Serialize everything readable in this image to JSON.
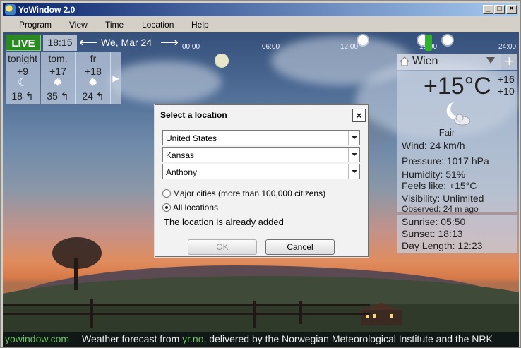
{
  "window": {
    "title": "YoWindow 2.0"
  },
  "menu": [
    "Program",
    "View",
    "Time",
    "Location",
    "Help"
  ],
  "timebar": {
    "live_label": "LIVE",
    "clock": "18:15",
    "date": "We, Mar 24",
    "ticks": [
      "00:00",
      "06:00",
      "12:00",
      "18:00",
      "24:00"
    ]
  },
  "forecast": [
    {
      "day": "tonight",
      "temp": "+9",
      "icon": "moon-icon",
      "wind": "18 ↰"
    },
    {
      "day": "tom.",
      "temp": "+17",
      "icon": "sun-icon",
      "wind": "35 ↰"
    },
    {
      "day": "fr",
      "temp": "+18",
      "icon": "sun-icon",
      "wind": "24 ↰"
    }
  ],
  "panel": {
    "city": "Wien",
    "temperature": "+15°C",
    "high": "+16",
    "low": "+10",
    "condition": "Fair",
    "wind": "Wind:  24 km/h",
    "pressure": "Pressure:  1017 hPa",
    "humidity": "Humidity:  51%",
    "feels_like": "Feels like:  +15°C",
    "visibility": "Visibility:   Unlimited",
    "observed": "Observed:   24 m ago",
    "sunrise": "Sunrise:   05:50",
    "sunset": "Sunset:   18:13",
    "day_length": "Day Length:   12:23"
  },
  "dialog": {
    "title": "Select a location",
    "country": "United States",
    "state": "Kansas",
    "city": "Anthony",
    "radio_major": "Major cities (more than 100,000 citizens)",
    "radio_all": "All locations",
    "message": "The location is already added",
    "ok_label": "OK",
    "cancel_label": "Cancel"
  },
  "footer": {
    "site": "yowindow.com",
    "credit_prefix": "Weather forecast from ",
    "credit_link": "yr.no",
    "credit_suffix": ", delivered by the Norwegian Meteorological Institute and the NRK"
  }
}
